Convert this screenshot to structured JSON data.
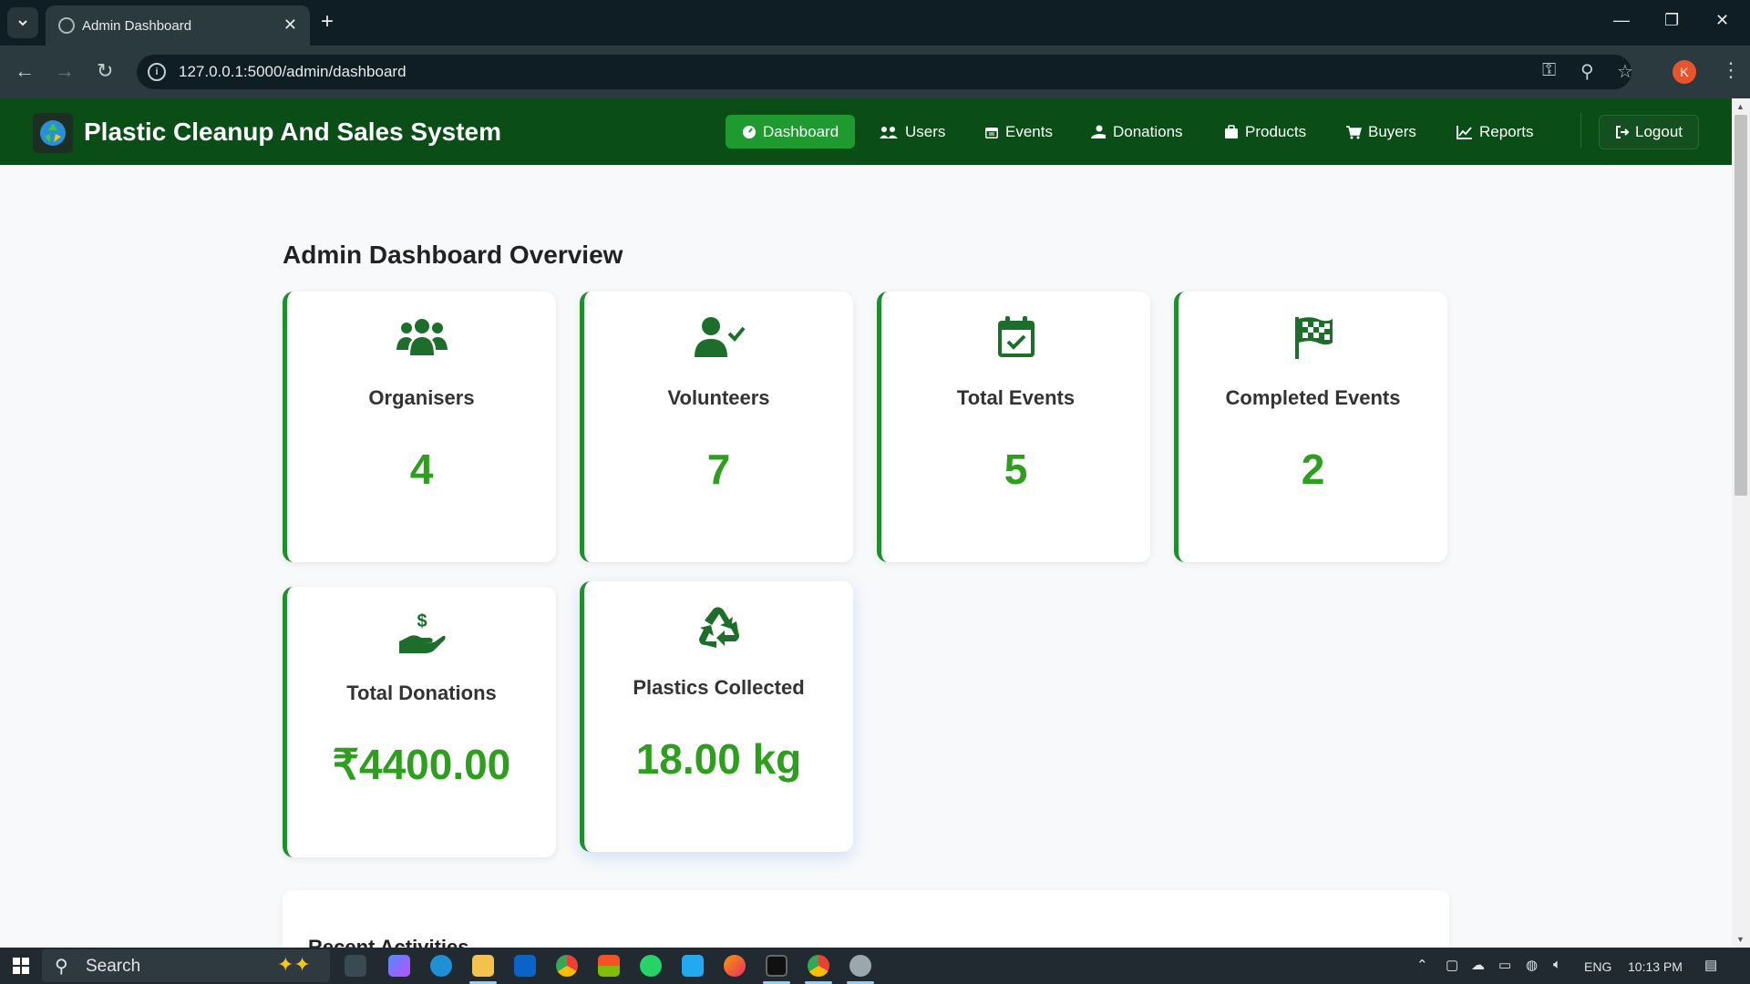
{
  "browser": {
    "tab_title": "Admin Dashboard",
    "url": "127.0.0.1:5000/admin/dashboard",
    "profile_initial": "K"
  },
  "app": {
    "brand": "Plastic Cleanup And Sales System",
    "nav": [
      {
        "label": "Dashboard",
        "icon": "dashboard-icon",
        "active": true
      },
      {
        "label": "Users",
        "icon": "users-icon"
      },
      {
        "label": "Events",
        "icon": "calendar-icon"
      },
      {
        "label": "Donations",
        "icon": "donation-icon"
      },
      {
        "label": "Products",
        "icon": "box-icon"
      },
      {
        "label": "Buyers",
        "icon": "cart-icon"
      },
      {
        "label": "Reports",
        "icon": "chart-line-icon"
      }
    ],
    "logout_label": "Logout"
  },
  "main": {
    "title": "Admin Dashboard Overview",
    "cards": [
      {
        "label": "Organisers",
        "value": "4",
        "icon": "users-group-icon"
      },
      {
        "label": "Volunteers",
        "value": "7",
        "icon": "user-check-icon"
      },
      {
        "label": "Total Events",
        "value": "5",
        "icon": "calendar-check-icon"
      },
      {
        "label": "Completed Events",
        "value": "2",
        "icon": "checkered-flag-icon"
      },
      {
        "label": "Total Donations",
        "value": "₹4400.00",
        "icon": "hand-dollar-icon"
      },
      {
        "label": "Plastics Collected",
        "value": "18.00 kg",
        "icon": "recycle-icon"
      }
    ],
    "recent_title": "Recent Activities"
  },
  "taskbar": {
    "search_placeholder": "Search",
    "language": "ENG",
    "time": "10:13 PM"
  },
  "colors": {
    "header": "#0a4d16",
    "accent": "#1f9a2f",
    "value_green": "#2f9e1f"
  }
}
